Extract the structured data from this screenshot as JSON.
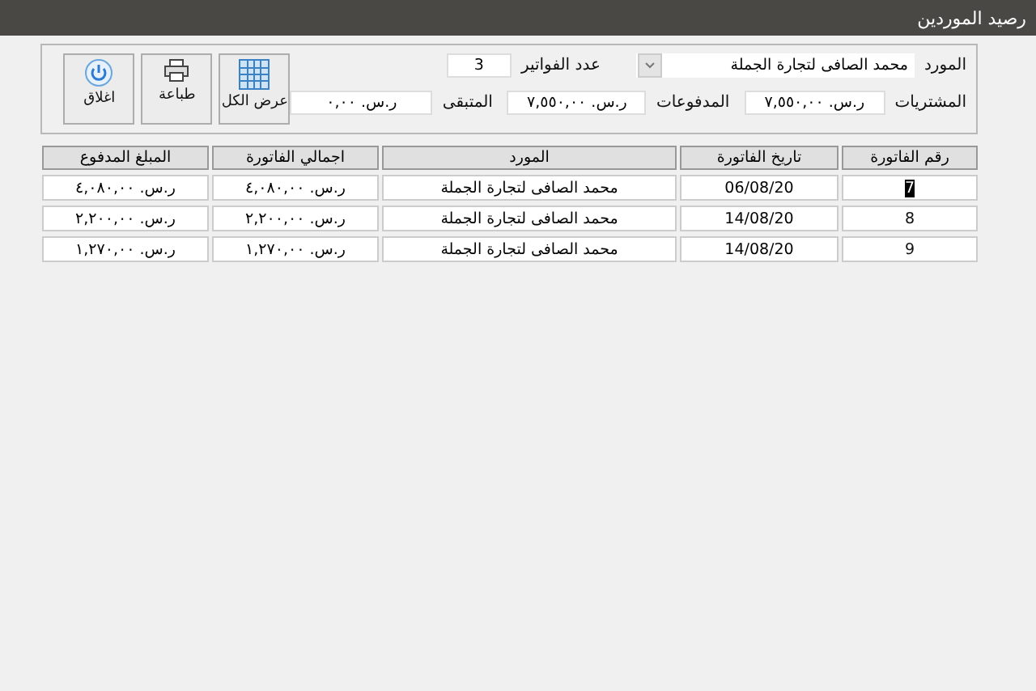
{
  "window": {
    "title": "رصيد الموردين"
  },
  "filters": {
    "supplier_label": "المورد",
    "supplier": "محمد الصافى لتجارة الجملة",
    "invoice_count_label": "عدد الفواتير",
    "invoice_count": "3"
  },
  "totals": [
    {
      "label": "المشتريات",
      "value": "ر.س. ٧,٥٥٠,٠٠"
    },
    {
      "label": "المدفوعات",
      "value": "ر.س. ٧,٥٥٠,٠٠"
    },
    {
      "label": "المتبقى",
      "value": "ر.س. ٠,٠٠"
    }
  ],
  "buttons": [
    {
      "kind": "grid",
      "label": "عرض الكل"
    },
    {
      "kind": "print",
      "label": "طباعة"
    },
    {
      "kind": "power",
      "label": "اغلاق"
    }
  ],
  "table": {
    "columns": [
      "رقم الفاتورة",
      "تاريخ الفاتورة",
      "المورد",
      "اجمالي الفاتورة",
      "المبلغ المدفوع"
    ],
    "rows": [
      {
        "selected": true,
        "cells": [
          "7",
          "06/08/20",
          "محمد الصافى لتجارة الجملة",
          "ر.س. ٤,٠٨٠,٠٠",
          "ر.س. ٤,٠٨٠,٠٠"
        ]
      },
      {
        "selected": false,
        "cells": [
          "8",
          "14/08/20",
          "محمد الصافى لتجارة الجملة",
          "ر.س. ٢,٢٠٠,٠٠",
          "ر.س. ٢,٢٠٠,٠٠"
        ]
      },
      {
        "selected": false,
        "cells": [
          "9",
          "14/08/20",
          "محمد الصافى لتجارة الجملة",
          "ر.س. ١,٢٧٠,٠٠",
          "ر.س. ١,٢٧٠,٠٠"
        ]
      }
    ]
  }
}
